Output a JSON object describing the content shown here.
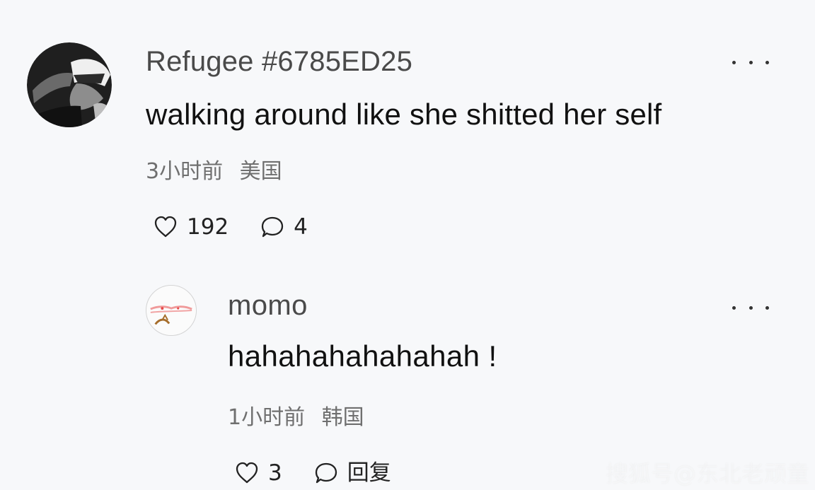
{
  "colors": {
    "background": "#f7f8fa",
    "username": "#4a4a4a",
    "text": "#111111",
    "meta": "#6f6f6f",
    "icon": "#222222"
  },
  "comments": [
    {
      "avatar_icon": "user-avatar",
      "username": "Refugee #6785ED25",
      "text": "walking around like she shitted her self",
      "time": "3小时前",
      "location": "美国",
      "likes": "192",
      "replies": "4",
      "more_icon": "more-dots-icon"
    },
    {
      "avatar_icon": "user-avatar",
      "username": "momo",
      "text": "hahahahahahahah !",
      "time": "1小时前",
      "location": "韩国",
      "likes": "3",
      "reply_label": "回复",
      "more_icon": "more-dots-icon"
    }
  ],
  "watermark": "搜狐号@东北老顽童"
}
